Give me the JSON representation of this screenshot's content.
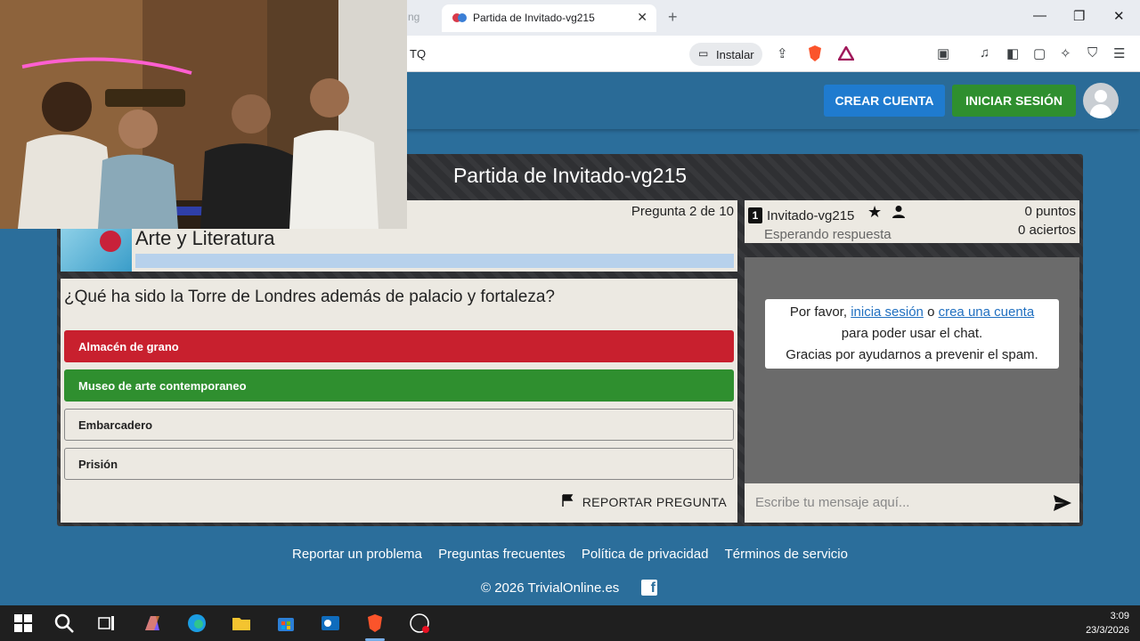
{
  "browser": {
    "partial_tab": "ng",
    "active_tab_title": "Partida de Invitado-vg215",
    "url_fragment": "TQ",
    "install_label": "Instalar"
  },
  "site": {
    "create_account": "CREAR CUENTA",
    "login": "INICIAR SESIÓN",
    "game_title": "Partida de Invitado-vg215"
  },
  "question": {
    "counter": "Pregunta 2 de 10",
    "category": "Arte y Literatura",
    "text": "¿Qué ha sido la Torre de Londres además de palacio y fortaleza?",
    "answers": [
      {
        "label": "Almacén de grano",
        "state": "wrong"
      },
      {
        "label": "Museo de arte contemporaneo",
        "state": "correct"
      },
      {
        "label": "Embarcadero",
        "state": "neutral"
      },
      {
        "label": "Prisión",
        "state": "neutral"
      }
    ],
    "report_label": "REPORTAR PREGUNTA"
  },
  "player": {
    "rank": "1",
    "name": "Invitado-vg215",
    "status": "Esperando respuesta",
    "points": "0 puntos",
    "hits": "0 aciertos"
  },
  "chat": {
    "notice_pre": "Por favor, ",
    "notice_link1": "inicia sesión",
    "notice_mid": " o ",
    "notice_link2": "crea una cuenta",
    "notice_line2": "para poder usar el chat.",
    "notice_line3": "Gracias por ayudarnos a prevenir el spam.",
    "placeholder": "Escribe tu mensaje aquí..."
  },
  "footer": {
    "links": [
      "Reportar un problema",
      "Preguntas frecuentes",
      "Política de privacidad",
      "Términos de servicio"
    ],
    "copyright": "© 2026 TrivialOnline.es"
  },
  "taskbar": {
    "time": "3:09",
    "date": "23/3/2026"
  },
  "colors": {
    "wrong": "#c8202e",
    "correct": "#2f8f2f",
    "site_bg": "#2b6e9b",
    "create_btn": "#1f7bcf"
  }
}
